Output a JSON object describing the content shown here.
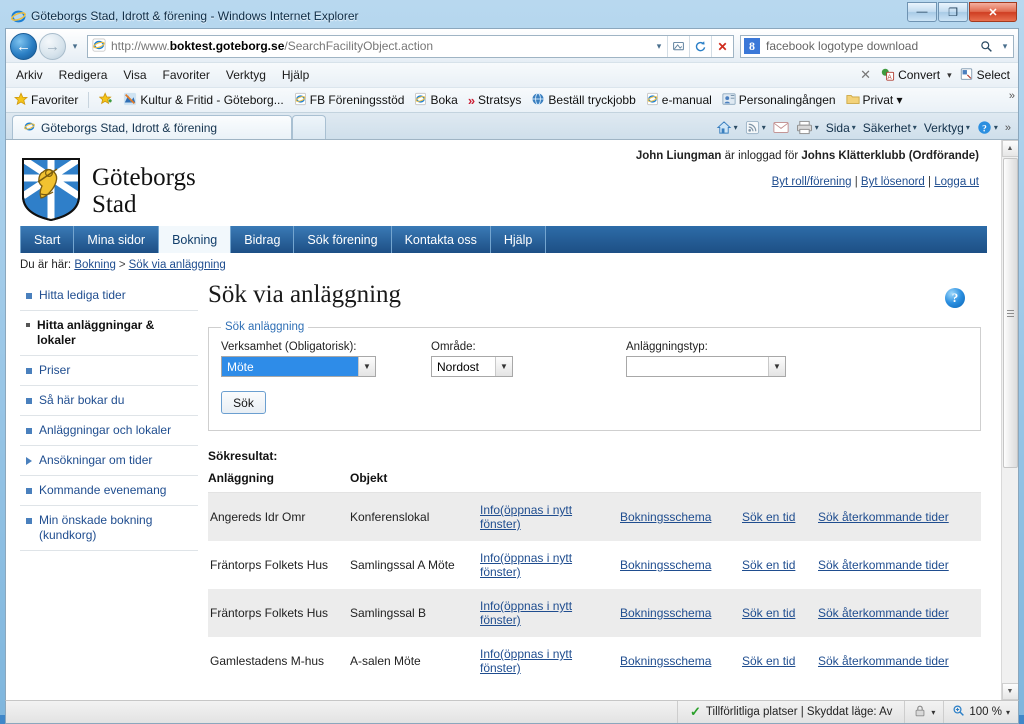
{
  "window": {
    "title": "Göteborgs Stad, Idrott & förening - Windows Internet Explorer",
    "minimize": "—",
    "maximize": "❐",
    "close": "✕"
  },
  "browser": {
    "url_scheme": "http://www.",
    "url_host": "boktest.goteborg.se",
    "url_path": "/SearchFacilityObject.action",
    "search_value": "facebook logotype download",
    "menu": [
      "Arkiv",
      "Redigera",
      "Visa",
      "Favoriter",
      "Verktyg",
      "Hjälp"
    ],
    "menu_right": {
      "close_label": "✕",
      "convert": "Convert",
      "select": "Select"
    },
    "favorites_label": "Favoriter",
    "favorites": [
      "Kultur & Fritid - Göteborg...",
      "FB Föreningsstöd",
      "Boka",
      "Stratsys",
      "Beställ tryckjobb",
      "e-manual",
      "Personalingången",
      "Privat ▾"
    ],
    "tab_title": "Göteborgs Stad, Idrott & förening",
    "toolbar": [
      "Sida",
      "Säkerhet",
      "Verktyg"
    ]
  },
  "status": {
    "zone": "Tillförlitliga platser | Skyddat läge: Av",
    "zoom": "100 %",
    "check": "✓"
  },
  "site": {
    "logo_line1": "Göteborgs",
    "logo_line2": "Stad",
    "user_name": "John Liungman",
    "user_middle": " är inloggad för ",
    "user_org": "Johns Klätterklubb (Ordförande)",
    "user_links": [
      "Byt roll/förening",
      "Byt lösenord",
      "Logga ut"
    ],
    "nav": [
      {
        "label": "Start",
        "active": false
      },
      {
        "label": "Mina sidor",
        "active": false
      },
      {
        "label": "Bokning",
        "active": true
      },
      {
        "label": "Bidrag",
        "active": false
      },
      {
        "label": "Sök förening",
        "active": false
      },
      {
        "label": "Kontakta oss",
        "active": false
      },
      {
        "label": "Hjälp",
        "active": false
      }
    ],
    "breadcrumb_prefix": "Du är här:",
    "breadcrumb": [
      "Bokning",
      "Sök via anläggning"
    ],
    "help_icon_label": "?"
  },
  "sidebar": {
    "items": [
      {
        "label": "Hitta lediga tider",
        "type": "bullet",
        "active": false
      },
      {
        "label": "Hitta anläggningar & lokaler",
        "type": "bullet",
        "active": true
      },
      {
        "label": "Priser",
        "type": "bullet",
        "active": false
      },
      {
        "label": "Så här bokar du",
        "type": "bullet",
        "active": false
      },
      {
        "label": "Anläggningar och lokaler",
        "type": "bullet",
        "active": false
      },
      {
        "label": "Ansökningar om tider",
        "type": "triangle",
        "active": false
      },
      {
        "label": "Kommande evenemang",
        "type": "bullet",
        "active": false
      },
      {
        "label": "Min önskade bokning (kundkorg)",
        "type": "bullet",
        "active": false
      }
    ]
  },
  "main": {
    "page_title": "Sök via anläggning",
    "fieldset_legend": "Sök anläggning",
    "fields": {
      "verksamhet_label": "Verksamhet (Obligatorisk):",
      "verksamhet_value": "Möte",
      "omrade_label": "Område:",
      "omrade_value": "Nordost",
      "anlaggningstyp_label": "Anläggningstyp:",
      "anlaggningstyp_value": ""
    },
    "submit_label": "Sök",
    "results_label": "Sökresultat:",
    "columns": [
      "Anläggning",
      "Objekt",
      "",
      "",
      "",
      ""
    ],
    "link_labels": {
      "info": "Info(öppnas i nytt fönster)",
      "schema": "Bokningsschema",
      "one_time": "Sök en tid",
      "recurring": "Sök återkommande tider"
    },
    "rows": [
      {
        "anlaggning": "Angereds Idr Omr",
        "objekt": "Konferenslokal"
      },
      {
        "anlaggning": "Fräntorps Folkets Hus",
        "objekt": "Samlingssal A Möte"
      },
      {
        "anlaggning": "Fräntorps Folkets Hus",
        "objekt": "Samlingssal B"
      },
      {
        "anlaggning": "Gamlestadens M-hus",
        "objekt": "A-salen Möte"
      }
    ]
  },
  "colors": {
    "nav_blue": "#1d4f85",
    "link_blue": "#1f4d8f",
    "select_highlight": "#2e8ce8",
    "row_alt": "#ececec"
  }
}
